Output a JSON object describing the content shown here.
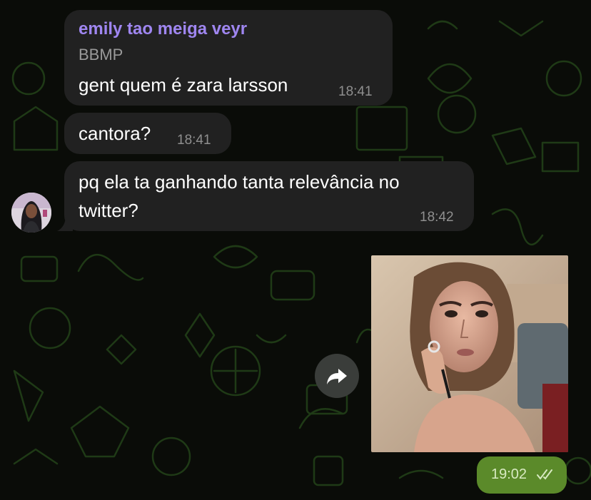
{
  "messages": [
    {
      "sender": "emily tao meiga veyr",
      "subtitle": "BBMP",
      "text": "gent quem é zara larsson",
      "time": "18:41"
    },
    {
      "text": "cantora?",
      "time": "18:41"
    },
    {
      "line1": "pq ela ta ganhando tanta relevância no",
      "line2": "twitter?",
      "time": "18:42"
    }
  ],
  "outgoing": {
    "time": "19:02",
    "status_icon": "double-check-icon"
  },
  "icons": {
    "share": "share-arrow-icon",
    "avatar": "avatar"
  },
  "colors": {
    "background": "#0a0c08",
    "incoming_bubble": "#212121",
    "sender_name": "#9f86f0",
    "outgoing_time_pill": "#5b8a2a"
  }
}
